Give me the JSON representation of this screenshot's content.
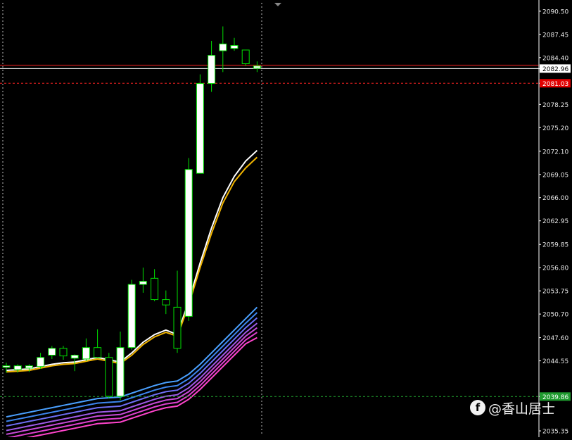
{
  "chart_data": {
    "type": "candlestick",
    "symbol": "",
    "y_axis": {
      "ticks": [
        "2090.50",
        "2087.45",
        "2084.40",
        "2082.96",
        "2081.03",
        "2078.25",
        "2075.20",
        "2072.10",
        "2069.05",
        "2066.00",
        "2062.95",
        "2059.85",
        "2056.80",
        "2053.75",
        "2050.70",
        "2047.60",
        "2044.55",
        "2039.86",
        "2035.35"
      ],
      "min": 2034.8,
      "max": 2091.6
    },
    "price_lines": [
      {
        "label": "2082.96",
        "value": 2082.96,
        "color": "#ffffff",
        "style": "solid"
      },
      {
        "label": "2081.03",
        "value": 2081.03,
        "color": "#ff2222",
        "style": "dashed"
      },
      {
        "label": "",
        "value": 2083.4,
        "color": "#ff2222",
        "style": "solid"
      },
      {
        "label": "2039.86",
        "value": 2039.86,
        "color": "#22aa33",
        "style": "dashed"
      }
    ],
    "candles": [
      {
        "o": 2043.7,
        "h": 2044.3,
        "l": 2043.0,
        "c": 2043.9
      },
      {
        "o": 2043.4,
        "h": 2044.1,
        "l": 2043.0,
        "c": 2043.9
      },
      {
        "o": 2043.6,
        "h": 2044.1,
        "l": 2043.1,
        "c": 2043.9
      },
      {
        "o": 2043.8,
        "h": 2045.6,
        "l": 2043.5,
        "c": 2045.0
      },
      {
        "o": 2045.3,
        "h": 2046.5,
        "l": 2044.8,
        "c": 2046.2
      },
      {
        "o": 2046.2,
        "h": 2046.5,
        "l": 2044.7,
        "c": 2045.2
      },
      {
        "o": 2044.9,
        "h": 2045.4,
        "l": 2043.2,
        "c": 2045.3
      },
      {
        "o": 2044.8,
        "h": 2047.5,
        "l": 2044.5,
        "c": 2046.3
      },
      {
        "o": 2046.3,
        "h": 2048.7,
        "l": 2045.0,
        "c": 2045.0
      },
      {
        "o": 2045.0,
        "h": 2045.6,
        "l": 2039.6,
        "c": 2039.9
      },
      {
        "o": 2039.9,
        "h": 2048.4,
        "l": 2039.4,
        "c": 2046.3
      },
      {
        "o": 2046.3,
        "h": 2055.2,
        "l": 2046.0,
        "c": 2054.6
      },
      {
        "o": 2054.6,
        "h": 2056.8,
        "l": 2053.5,
        "c": 2055.0
      },
      {
        "o": 2055.4,
        "h": 2056.6,
        "l": 2052.4,
        "c": 2052.6
      },
      {
        "o": 2052.6,
        "h": 2053.8,
        "l": 2050.7,
        "c": 2051.9
      },
      {
        "o": 2051.6,
        "h": 2056.4,
        "l": 2045.6,
        "c": 2046.2
      },
      {
        "o": 2050.4,
        "h": 2071.2,
        "l": 2049.8,
        "c": 2069.7
      },
      {
        "o": 2069.2,
        "h": 2082.2,
        "l": 2069.2,
        "c": 2081.0
      },
      {
        "o": 2081.0,
        "h": 2086.6,
        "l": 2079.9,
        "c": 2084.7
      },
      {
        "o": 2085.3,
        "h": 2088.5,
        "l": 2082.5,
        "c": 2086.2
      },
      {
        "o": 2085.6,
        "h": 2087.0,
        "l": 2085.3,
        "c": 2086.0
      },
      {
        "o": 2085.4,
        "h": 2085.4,
        "l": 2083.3,
        "c": 2083.6
      },
      {
        "o": 2083.0,
        "h": 2083.9,
        "l": 2082.5,
        "c": 2083.3
      }
    ],
    "moving_averages": [
      {
        "color": "#ffffff",
        "values": [
          2043.3,
          2043.4,
          2043.5,
          2043.8,
          2044.1,
          2044.3,
          2044.4,
          2044.7,
          2045.0,
          2044.7,
          2044.4,
          2045.6,
          2047.0,
          2048.0,
          2048.6,
          2048.0,
          2052.4,
          2057.4,
          2062.0,
          2066.0,
          2068.8,
          2070.8,
          2072.2
        ]
      },
      {
        "color": "#f0b400",
        "values": [
          2043.1,
          2043.2,
          2043.3,
          2043.6,
          2043.9,
          2044.1,
          2044.2,
          2044.5,
          2044.8,
          2044.5,
          2044.2,
          2045.3,
          2046.7,
          2047.7,
          2048.3,
          2047.8,
          2051.9,
          2056.8,
          2061.3,
          2065.3,
          2068.1,
          2069.9,
          2071.3
        ]
      },
      {
        "color": "#4aa0ff",
        "values": [
          2037.2,
          2037.5,
          2037.8,
          2038.1,
          2038.4,
          2038.7,
          2039.0,
          2039.3,
          2039.6,
          2039.7,
          2039.8,
          2040.3,
          2040.8,
          2041.3,
          2041.7,
          2041.9,
          2042.8,
          2044.1,
          2045.6,
          2047.1,
          2048.6,
          2050.1,
          2051.6
        ]
      },
      {
        "color": "#3d86f0",
        "values": [
          2036.6,
          2036.9,
          2037.2,
          2037.5,
          2037.8,
          2038.1,
          2038.4,
          2038.7,
          2039.0,
          2039.1,
          2039.2,
          2039.7,
          2040.2,
          2040.7,
          2041.1,
          2041.3,
          2042.2,
          2043.5,
          2045.0,
          2046.5,
          2048.0,
          2049.5,
          2050.9
        ]
      },
      {
        "color": "#6f6ff5",
        "values": [
          2036.0,
          2036.3,
          2036.6,
          2036.9,
          2037.2,
          2037.5,
          2037.8,
          2038.1,
          2038.4,
          2038.5,
          2038.6,
          2039.1,
          2039.6,
          2040.1,
          2040.5,
          2040.7,
          2041.6,
          2042.9,
          2044.4,
          2045.9,
          2047.4,
          2048.9,
          2050.2
        ]
      },
      {
        "color": "#a05ae8",
        "values": [
          2035.4,
          2035.7,
          2036.0,
          2036.3,
          2036.6,
          2036.9,
          2037.2,
          2037.5,
          2037.8,
          2037.9,
          2038.0,
          2038.5,
          2039.0,
          2039.5,
          2039.9,
          2040.1,
          2041.0,
          2042.3,
          2043.8,
          2045.3,
          2046.8,
          2048.3,
          2049.5
        ]
      },
      {
        "color": "#c94ad8",
        "values": [
          2034.9,
          2035.2,
          2035.5,
          2035.8,
          2036.1,
          2036.4,
          2036.7,
          2037.0,
          2037.3,
          2037.4,
          2037.5,
          2038.0,
          2038.5,
          2039.0,
          2039.4,
          2039.6,
          2040.5,
          2041.8,
          2043.3,
          2044.8,
          2046.3,
          2047.8,
          2048.9
        ]
      },
      {
        "color": "#e040d0",
        "values": [
          2034.4,
          2034.7,
          2035.0,
          2035.3,
          2035.6,
          2035.9,
          2036.2,
          2036.5,
          2036.8,
          2036.9,
          2037.0,
          2037.5,
          2038.0,
          2038.5,
          2038.9,
          2039.1,
          2040.0,
          2041.3,
          2042.8,
          2044.3,
          2045.8,
          2047.3,
          2048.3
        ]
      },
      {
        "color": "#ff44cc",
        "values": [
          2033.9,
          2034.2,
          2034.5,
          2034.8,
          2035.1,
          2035.4,
          2035.7,
          2036.0,
          2036.3,
          2036.4,
          2036.5,
          2037.0,
          2037.5,
          2038.0,
          2038.4,
          2038.6,
          2039.5,
          2040.8,
          2042.3,
          2043.8,
          2045.3,
          2046.8,
          2047.6
        ]
      }
    ],
    "grid": false,
    "colors": {
      "background": "#000000",
      "bull_body": "#ffffff",
      "bear_body": "#000000",
      "candle_outline": "#00e000",
      "axis": "#ffffff",
      "text": "#e6e6e6"
    }
  },
  "watermark": {
    "logo": "f",
    "text": "@香山居士"
  }
}
